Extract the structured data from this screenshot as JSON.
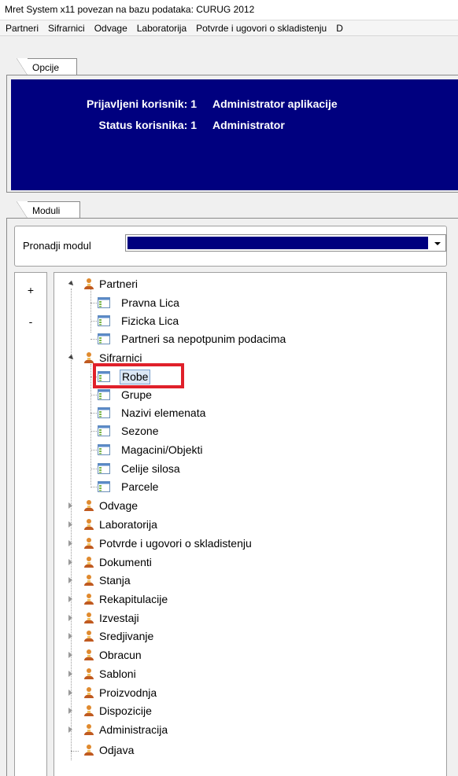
{
  "window": {
    "title": "Mret System x11 povezan na bazu podataka: CURUG 2012"
  },
  "menu": [
    "Partneri",
    "Sifrarnici",
    "Odvage",
    "Laboratorija",
    "Potvrde i ugovori o skladistenju",
    "D"
  ],
  "opcije": {
    "tab_label": "Opcije",
    "user_label": "Prijavljeni korisnik: 1",
    "user_value": "Administrator aplikacije",
    "status_label": "Status korisnika: 1",
    "status_value": "Administrator"
  },
  "moduli": {
    "tab_label": "Moduli",
    "finder_label": "Pronadji modul",
    "buttons": {
      "expand": "+",
      "collapse": "-"
    }
  },
  "colors": {
    "panel_blue": "#00007f",
    "highlight_red": "#e0202a",
    "selection_bg": "#dbe7f6"
  },
  "tree": {
    "partneri": {
      "label": "Partneri",
      "children": [
        "Pravna Lica",
        "Fizicka Lica",
        "Partneri sa nepotpunim podacima"
      ]
    },
    "sifrarnici": {
      "label": "Sifrarnici",
      "children": [
        "Robe",
        "Grupe",
        "Nazivi elemenata",
        "Sezone",
        "Magacini/Objekti",
        "Celije silosa",
        "Parcele"
      ]
    },
    "collapsed": [
      "Odvage",
      "Laboratorija",
      "Potvrde i ugovori o skladistenju",
      "Dokumenti",
      "Stanja",
      "Rekapitulacije",
      "Izvestaji",
      "Sredjivanje",
      "Obracun",
      "Sabloni",
      "Proizvodnja",
      "Dispozicije",
      "Administracija"
    ],
    "last": "Odjava",
    "selected": "Robe"
  }
}
